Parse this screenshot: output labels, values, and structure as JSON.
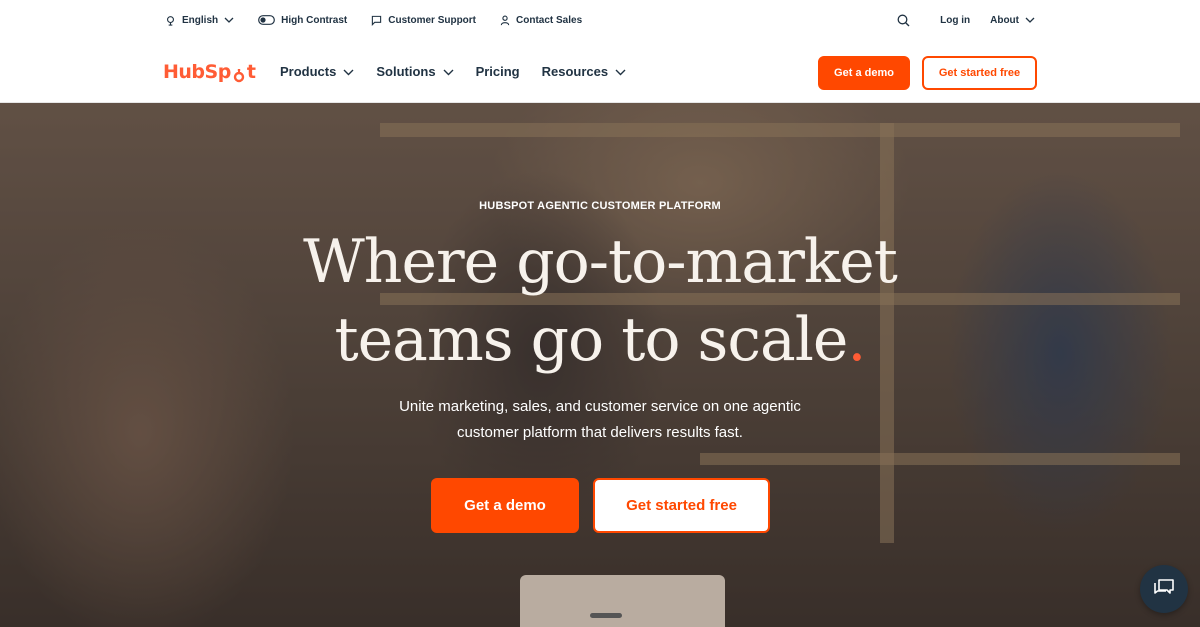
{
  "utility": {
    "language": "English",
    "high_contrast": "High Contrast",
    "customer_support": "Customer Support",
    "contact_sales": "Contact Sales",
    "login": "Log in",
    "about": "About"
  },
  "nav": {
    "logo": "HubSpot",
    "items": [
      {
        "label": "Products",
        "dropdown": true
      },
      {
        "label": "Solutions",
        "dropdown": true
      },
      {
        "label": "Pricing",
        "dropdown": false
      },
      {
        "label": "Resources",
        "dropdown": true
      }
    ],
    "demo_button": "Get a demo",
    "started_button": "Get started free"
  },
  "hero": {
    "eyebrow": "HUBSPOT AGENTIC CUSTOMER PLATFORM",
    "headline_line1": "Where go-to-market",
    "headline_line2": "teams go to scale",
    "headline_dot": ".",
    "subtitle_line1": "Unite marketing, sales, and customer service on one agentic",
    "subtitle_line2": "customer platform that delivers results fast.",
    "demo_button": "Get a demo",
    "started_button": "Get started free"
  },
  "colors": {
    "brand": "#ff4800",
    "text": "#213343"
  },
  "icons": [
    "globe-icon",
    "toggle-icon",
    "chat-bubble-icon",
    "person-icon",
    "search-icon",
    "chevron-down-icon",
    "chat-launcher-icon"
  ]
}
